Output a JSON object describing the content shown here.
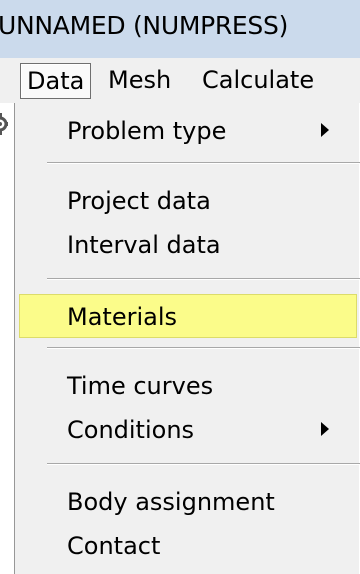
{
  "window": {
    "title": "UNNAMED (NUMPRESS)"
  },
  "menubar": {
    "items": [
      {
        "label": "Data",
        "active": true
      },
      {
        "label": "Mesh",
        "active": false
      },
      {
        "label": "Calculate",
        "active": false
      }
    ]
  },
  "dropdown": {
    "items": [
      {
        "label": "Problem type",
        "submenu": true
      },
      {
        "label": "Project data",
        "submenu": false
      },
      {
        "label": "Interval data",
        "submenu": false
      },
      {
        "label": "Materials",
        "submenu": false,
        "highlighted": true
      },
      {
        "label": "Time curves",
        "submenu": false
      },
      {
        "label": "Conditions",
        "submenu": true
      },
      {
        "label": "Body assignment",
        "submenu": false
      },
      {
        "label": "Contact",
        "submenu": false
      }
    ]
  },
  "colors": {
    "highlight": "#fbfc8a",
    "menu_background": "#f0f0f0",
    "titlebar": "#cbdaec"
  },
  "icons": {
    "left_strip": "gear-icon",
    "submenu": "chevron-right-icon"
  }
}
